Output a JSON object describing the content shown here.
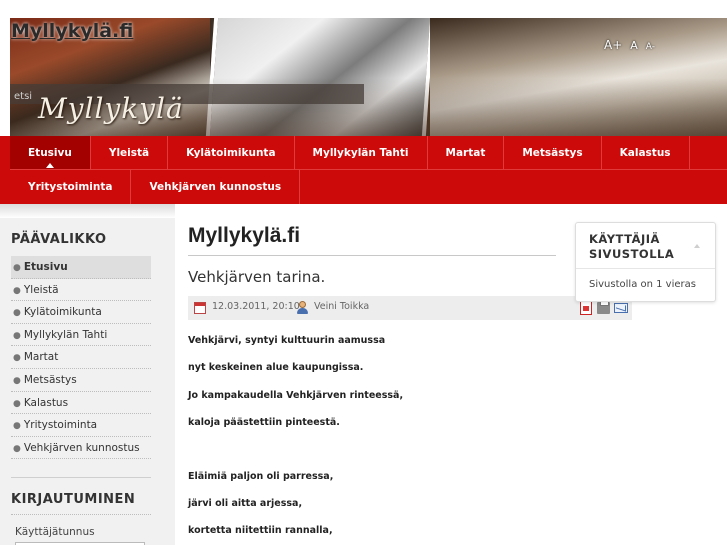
{
  "header": {
    "site_title": "Myllykylä.fi",
    "banner_script": "Myllykylä",
    "search_placeholder": "etsi",
    "font_sizer": {
      "increase": "A+",
      "reset": "A",
      "decrease": "A-"
    }
  },
  "nav": {
    "row1": [
      "Etusivu",
      "Yleistä",
      "Kylätoimikunta",
      "Myllykylän Tahti",
      "Martat",
      "Metsästys",
      "Kalastus"
    ],
    "row2": [
      "Yritystoiminta",
      "Vehkjärven kunnostus"
    ],
    "active": "Etusivu"
  },
  "sidebar": {
    "main_menu_title": "PÄÄVALIKKO",
    "items": [
      {
        "label": "Etusivu",
        "active": true
      },
      {
        "label": "Yleistä",
        "active": false
      },
      {
        "label": "Kylätoimikunta",
        "active": false
      },
      {
        "label": "Myllykylän Tahti",
        "active": false
      },
      {
        "label": "Martat",
        "active": false
      },
      {
        "label": "Metsästys",
        "active": false
      },
      {
        "label": "Kalastus",
        "active": false
      },
      {
        "label": "Yritystoiminta",
        "active": false
      },
      {
        "label": "Vehkjärven kunnostus",
        "active": false
      }
    ],
    "login_title": "KIRJAUTUMINEN",
    "username_label": "Käyttäjätunnus"
  },
  "main": {
    "page_title": "Myllykylä.fi",
    "article_title": "Vehkjärven tarina.",
    "meta": {
      "date": "12.03.2011, 20:10",
      "author": "Veini Toikka"
    },
    "poem_lines": [
      "Vehkjärvi, syntyi kulttuurin aamussa",
      "nyt keskeinen alue kaupungissa.",
      "Jo kampakaudella Vehkjärven rinteessä,",
      "kaloja päästettiin pinteestä.",
      "",
      "Eläimiä paljon oli parressa,",
      "järvi oli aitta arjessa,",
      "kortetta niitettiin rannalla,"
    ]
  },
  "users_module": {
    "title_line1": "KÄYTTÄJIÄ",
    "title_line2": "SIVUSTOLLA",
    "text": "Sivustolla on 1 vieras"
  },
  "colors": {
    "nav_red": "#cc0a0a",
    "nav_active": "#a30000",
    "sidebar_bg": "#f1f1f1"
  },
  "icons": [
    "calendar-icon",
    "user-icon",
    "pdf-icon",
    "print-icon",
    "email-icon",
    "collapse-icon"
  ]
}
